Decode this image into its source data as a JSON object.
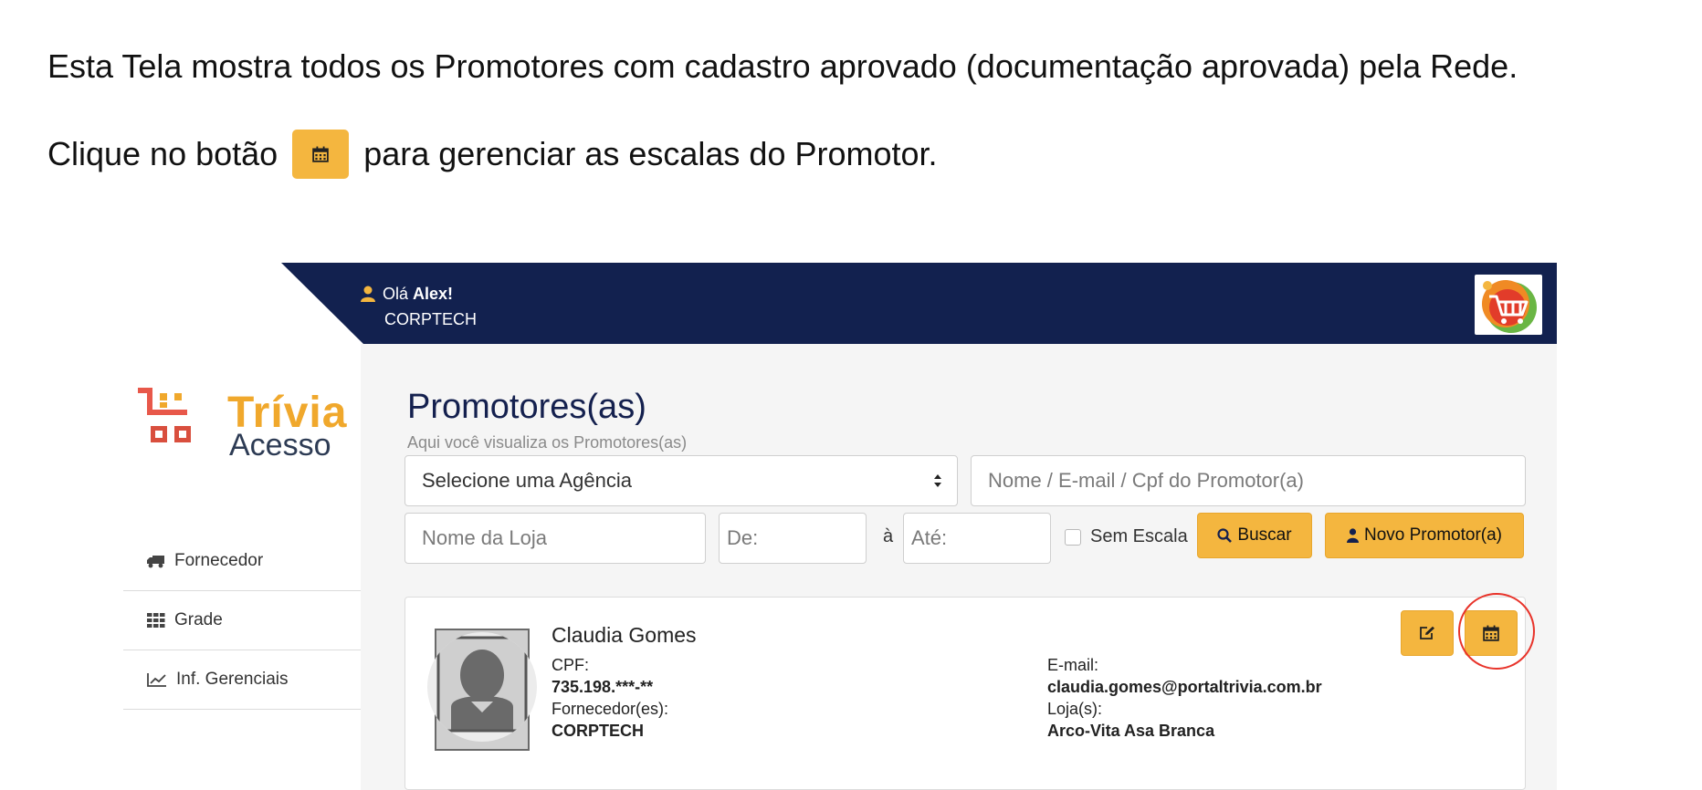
{
  "instructions": {
    "line1": "Esta Tela mostra todos os Promotores com cadastro aprovado (documentação aprovada) pela Rede.",
    "line2_before": "Clique no botão",
    "line2_after": "para gerenciar as escalas do Promotor.",
    "inline_button_icon": "calendar-icon"
  },
  "header": {
    "greeting_prefix": "Olá ",
    "user_name": "Alex!",
    "company": "CORPTECH",
    "user_icon": "user-icon",
    "logo_icon": "shopping-cart-icon",
    "bg_color": "#12214f"
  },
  "brand": {
    "name_line1": "Trívia",
    "name_line2": "Acesso"
  },
  "sidebar": {
    "items": [
      {
        "label": "Fornecedor",
        "icon": "truck-icon"
      },
      {
        "label": "Grade",
        "icon": "grid-icon"
      },
      {
        "label": "Inf. Gerenciais",
        "icon": "line-chart-icon"
      }
    ]
  },
  "main": {
    "title": "Promotores(as)",
    "subtitle": "Aqui você visualiza os Promotores(as)"
  },
  "filters": {
    "agency_select": "Selecione uma Agência",
    "search_placeholder": "Nome / E-mail / Cpf do Promotor(a)",
    "store_placeholder": "Nome da Loja",
    "from_placeholder": "De:",
    "to_label": "à",
    "to_placeholder": "Até:",
    "no_scale_label": "Sem Escala",
    "no_scale_checked": false,
    "search_button": "Buscar",
    "new_button": "Novo Promotor(a)"
  },
  "promoter": {
    "name": "Claudia Gomes",
    "cpf_label": "CPF:",
    "cpf": "735.198.***-**",
    "suppliers_label": "Fornecedor(es):",
    "suppliers": "CORPTECH",
    "email_label": "E-mail:",
    "email": "claudia.gomes@portaltrivia.com.br",
    "stores_label": "Loja(s):",
    "stores": "Arco-Vita Asa Branca"
  },
  "colors": {
    "accent": "#f4b63f",
    "title": "#14204e",
    "highlight": "#e8332a"
  }
}
